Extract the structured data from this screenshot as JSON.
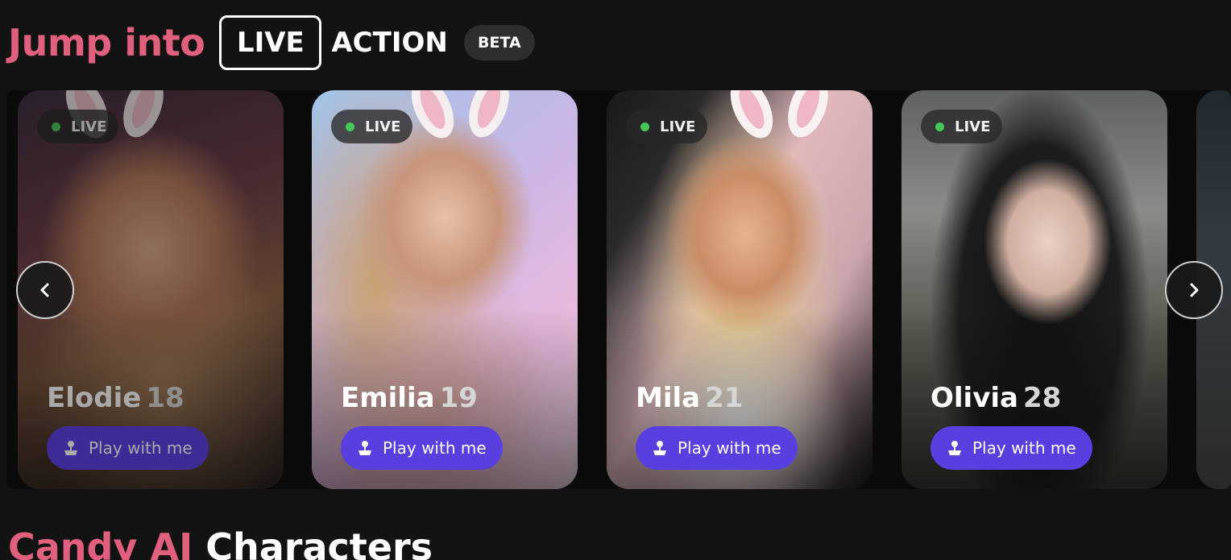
{
  "header": {
    "jump": "Jump into",
    "live": "LIVE",
    "action": "ACTION",
    "beta": "BETA"
  },
  "cards": [
    {
      "name": "Elodie",
      "age": "18",
      "live_label": "LIVE",
      "cta": "Play with me"
    },
    {
      "name": "Emilia",
      "age": "19",
      "live_label": "LIVE",
      "cta": "Play with me"
    },
    {
      "name": "Mila",
      "age": "21",
      "live_label": "LIVE",
      "cta": "Play with me"
    },
    {
      "name": "Olivia",
      "age": "28",
      "live_label": "LIVE",
      "cta": "Play with me"
    }
  ],
  "nav": {
    "prev_icon": "chevron-left-icon",
    "next_icon": "chevron-right-icon"
  },
  "section": {
    "highlight": "Candy AI",
    "rest": "Characters"
  },
  "colors": {
    "accent_pink": "#e0607e",
    "button_purple": "#5a3fe0",
    "live_green": "#45c75a",
    "background": "#131313"
  }
}
